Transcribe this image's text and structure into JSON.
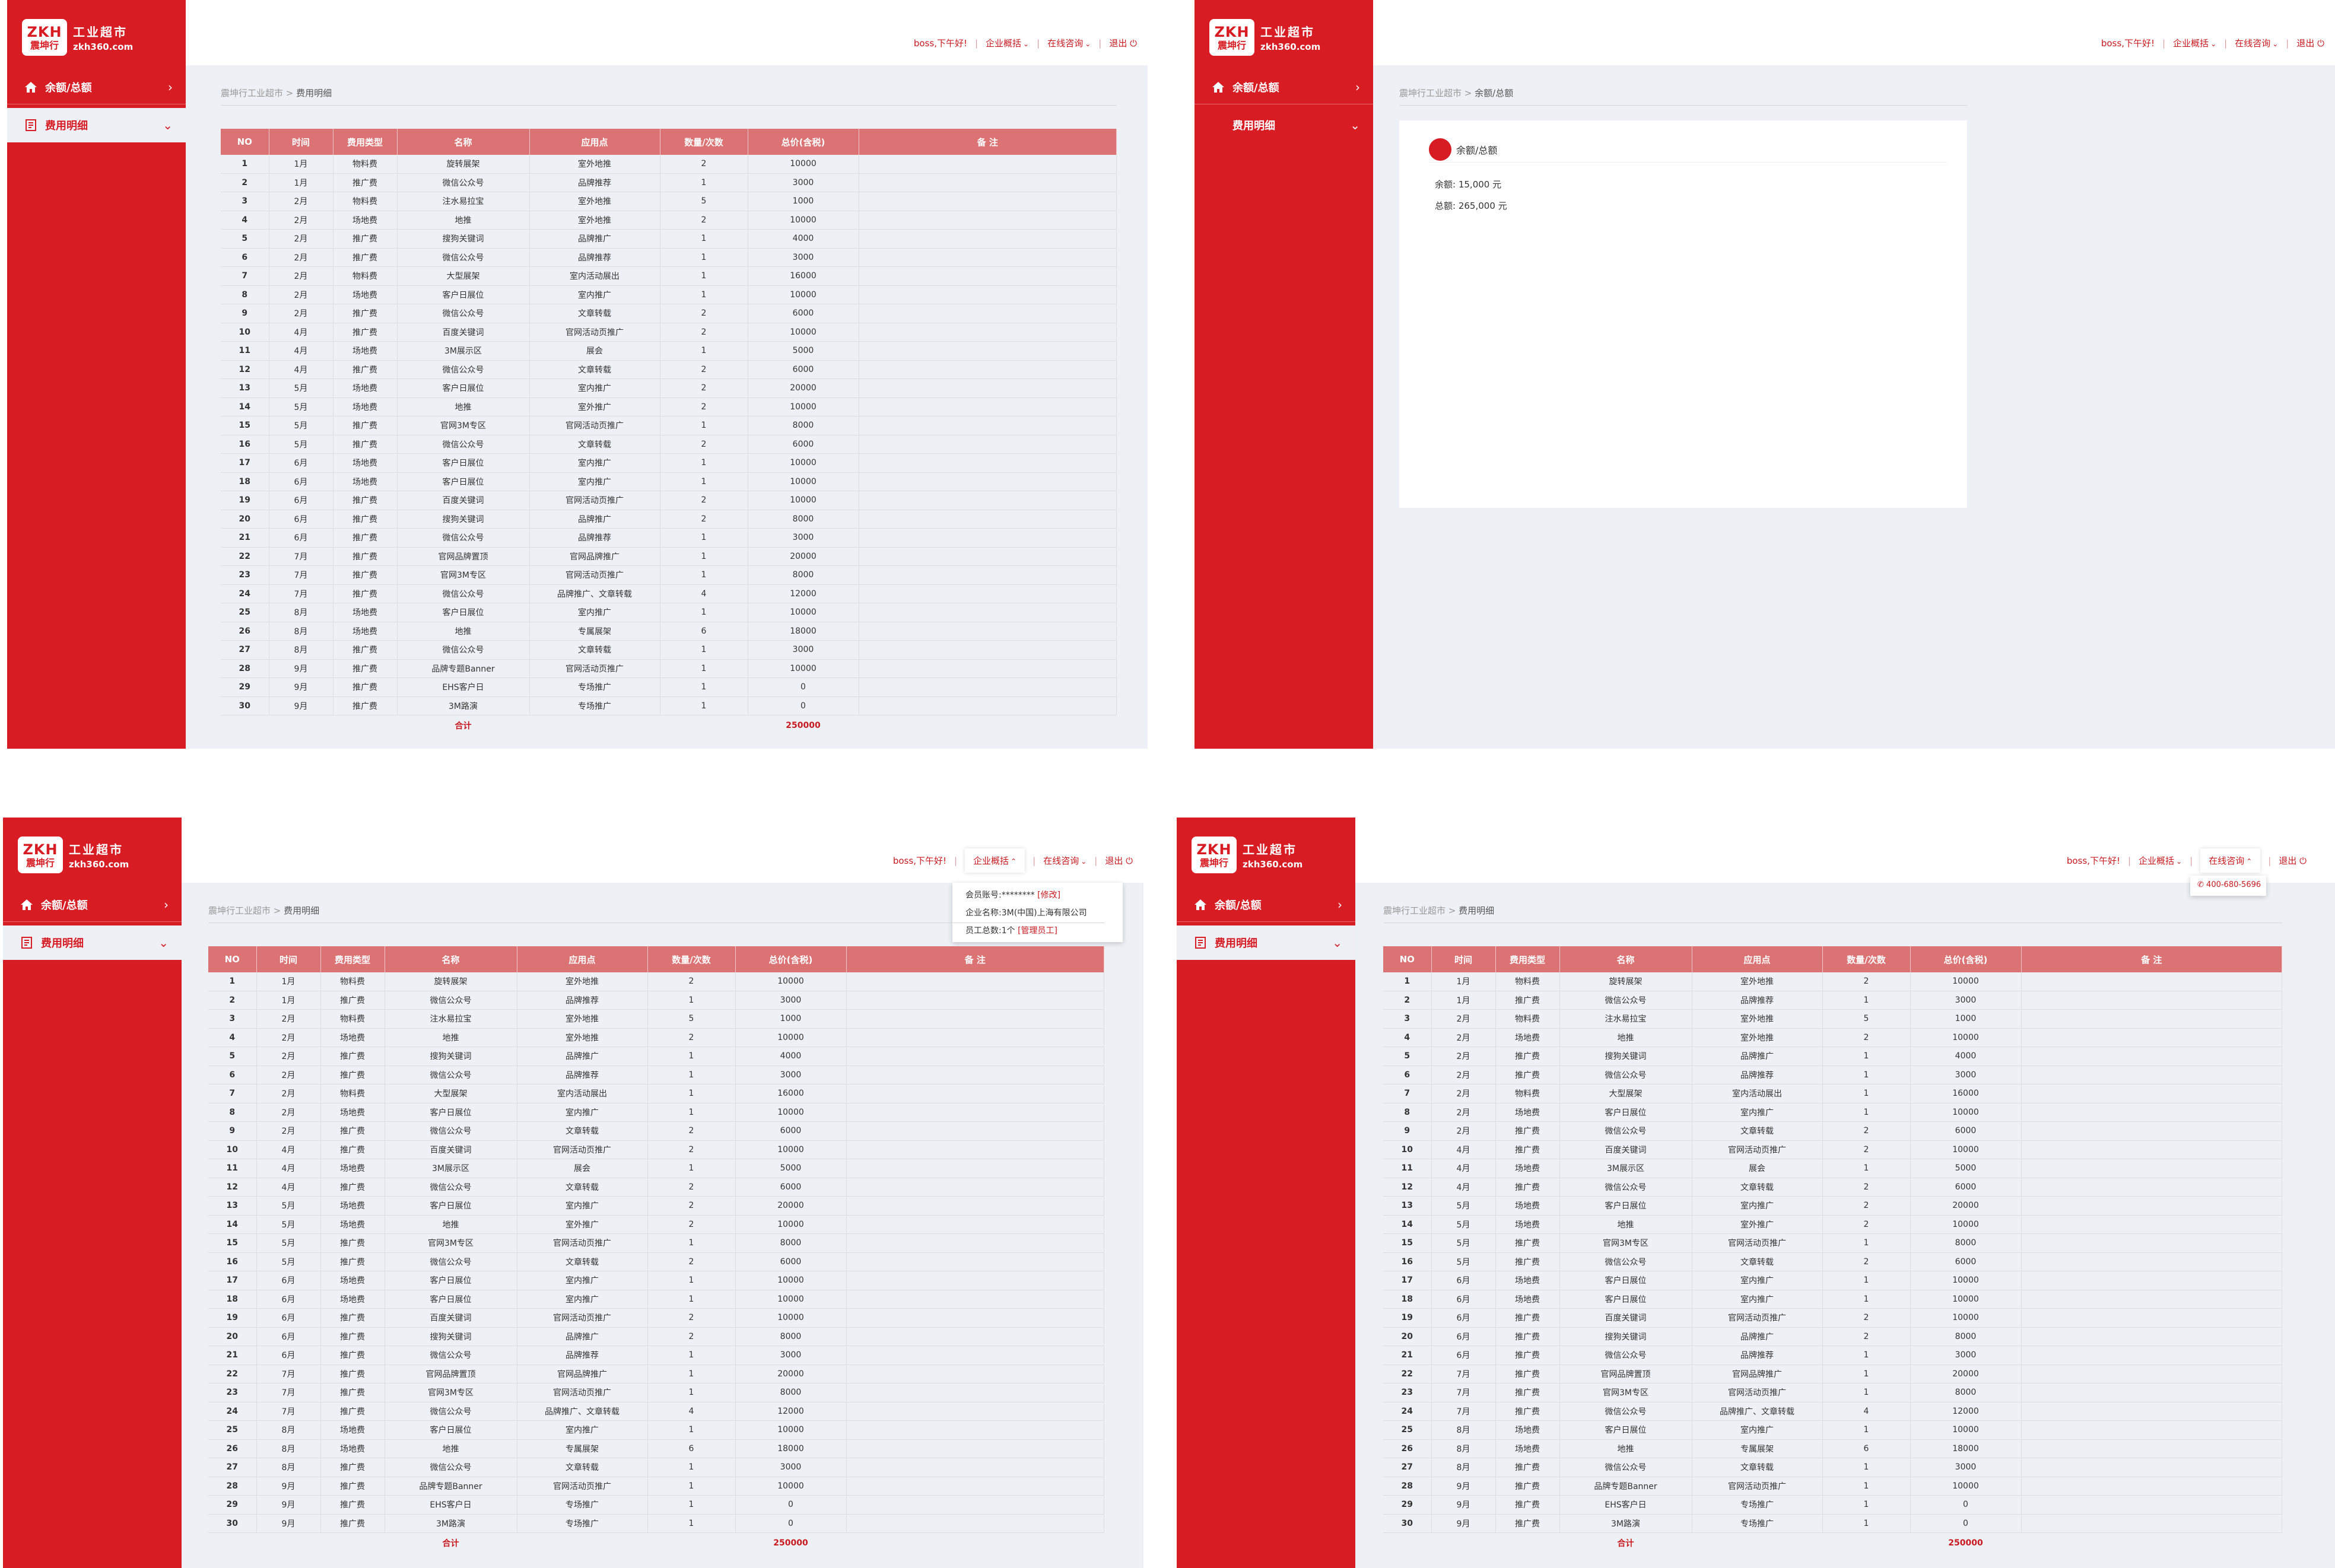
{
  "brand": {
    "logo_abbr": "ZKH",
    "logo_cn": "震坤行",
    "name": "工业超市",
    "site": "zkh360.com"
  },
  "sidebar": {
    "balance_label": "余额/总额",
    "detail_label": "费用明细"
  },
  "topnav": {
    "greeting": "boss,下午好!",
    "overview": "企业概括",
    "consult": "在线咨询",
    "logout": "退出"
  },
  "breadcrumb": {
    "root": "震坤行工业超市",
    "sep": ">",
    "detail": "费用明细",
    "balance": "余额/总额"
  },
  "table": {
    "headers": [
      "NO",
      "时间",
      "费用类型",
      "名称",
      "应用点",
      "数量/次数",
      "总价(含税)",
      "备 注"
    ],
    "rows": [
      [
        "1",
        "1月",
        "物料费",
        "旋转展架",
        "室外地推",
        "2",
        "10000",
        ""
      ],
      [
        "2",
        "1月",
        "推广费",
        "微信公众号",
        "品牌推荐",
        "1",
        "3000",
        ""
      ],
      [
        "3",
        "2月",
        "物料费",
        "注水易拉宝",
        "室外地推",
        "5",
        "1000",
        ""
      ],
      [
        "4",
        "2月",
        "场地费",
        "地推",
        "室外地推",
        "2",
        "10000",
        ""
      ],
      [
        "5",
        "2月",
        "推广费",
        "搜狗关键词",
        "品牌推广",
        "1",
        "4000",
        ""
      ],
      [
        "6",
        "2月",
        "推广费",
        "微信公众号",
        "品牌推荐",
        "1",
        "3000",
        ""
      ],
      [
        "7",
        "2月",
        "物料费",
        "大型展架",
        "室内活动展出",
        "1",
        "16000",
        ""
      ],
      [
        "8",
        "2月",
        "场地费",
        "客户日展位",
        "室内推广",
        "1",
        "10000",
        ""
      ],
      [
        "9",
        "2月",
        "推广费",
        "微信公众号",
        "文章转载",
        "2",
        "6000",
        ""
      ],
      [
        "10",
        "4月",
        "推广费",
        "百度关键词",
        "官网活动页推广",
        "2",
        "10000",
        ""
      ],
      [
        "11",
        "4月",
        "场地费",
        "3M展示区",
        "展会",
        "1",
        "5000",
        ""
      ],
      [
        "12",
        "4月",
        "推广费",
        "微信公众号",
        "文章转载",
        "2",
        "6000",
        ""
      ],
      [
        "13",
        "5月",
        "场地费",
        "客户日展位",
        "室内推广",
        "2",
        "20000",
        ""
      ],
      [
        "14",
        "5月",
        "场地费",
        "地推",
        "室外推广",
        "2",
        "10000",
        ""
      ],
      [
        "15",
        "5月",
        "推广费",
        "官网3M专区",
        "官网活动页推广",
        "1",
        "8000",
        ""
      ],
      [
        "16",
        "5月",
        "推广费",
        "微信公众号",
        "文章转载",
        "2",
        "6000",
        ""
      ],
      [
        "17",
        "6月",
        "场地费",
        "客户日展位",
        "室内推广",
        "1",
        "10000",
        ""
      ],
      [
        "18",
        "6月",
        "场地费",
        "客户日展位",
        "室内推广",
        "1",
        "10000",
        ""
      ],
      [
        "19",
        "6月",
        "推广费",
        "百度关键词",
        "官网活动页推广",
        "2",
        "10000",
        ""
      ],
      [
        "20",
        "6月",
        "推广费",
        "搜狗关键词",
        "品牌推广",
        "2",
        "8000",
        ""
      ],
      [
        "21",
        "6月",
        "推广费",
        "微信公众号",
        "品牌推荐",
        "1",
        "3000",
        ""
      ],
      [
        "22",
        "7月",
        "推广费",
        "官网品牌置顶",
        "官网品牌推广",
        "1",
        "20000",
        ""
      ],
      [
        "23",
        "7月",
        "推广费",
        "官网3M专区",
        "官网活动页推广",
        "1",
        "8000",
        ""
      ],
      [
        "24",
        "7月",
        "推广费",
        "微信公众号",
        "品牌推广、文章转载",
        "4",
        "12000",
        ""
      ],
      [
        "25",
        "8月",
        "场地费",
        "客户日展位",
        "室内推广",
        "1",
        "10000",
        ""
      ],
      [
        "26",
        "8月",
        "场地费",
        "地推",
        "专属展架",
        "6",
        "18000",
        ""
      ],
      [
        "27",
        "8月",
        "推广费",
        "微信公众号",
        "文章转载",
        "1",
        "3000",
        ""
      ],
      [
        "28",
        "9月",
        "推广费",
        "品牌专题Banner",
        "官网活动页推广",
        "1",
        "10000",
        ""
      ],
      [
        "29",
        "9月",
        "推广费",
        "EHS客户日",
        "专场推广",
        "1",
        "0",
        ""
      ],
      [
        "30",
        "9月",
        "推广费",
        "3M路演",
        "专场推广",
        "1",
        "0",
        ""
      ]
    ],
    "total_label": "合计",
    "total_value": "250000"
  },
  "balance_card": {
    "title": "余额/总额",
    "balance_label": "余额:",
    "balance_value": "15,000 元",
    "total_label": "总额:",
    "total_value": "265,000 元"
  },
  "account_dropdown": {
    "account_label": "会员账号:",
    "account_value": "********",
    "modify_link": "[修改]",
    "company_label": "企业名称:",
    "company_value": "3M(中国)上海有限公司",
    "staff_label": "员工总数:",
    "staff_value": "1个",
    "manage_link": "[管理员工]"
  },
  "phone_dropdown": {
    "phone": "400-680-5696"
  },
  "colors": {
    "brand_red": "#d71c23",
    "header_red": "#db7274",
    "bg_gray": "#edf0f5"
  }
}
